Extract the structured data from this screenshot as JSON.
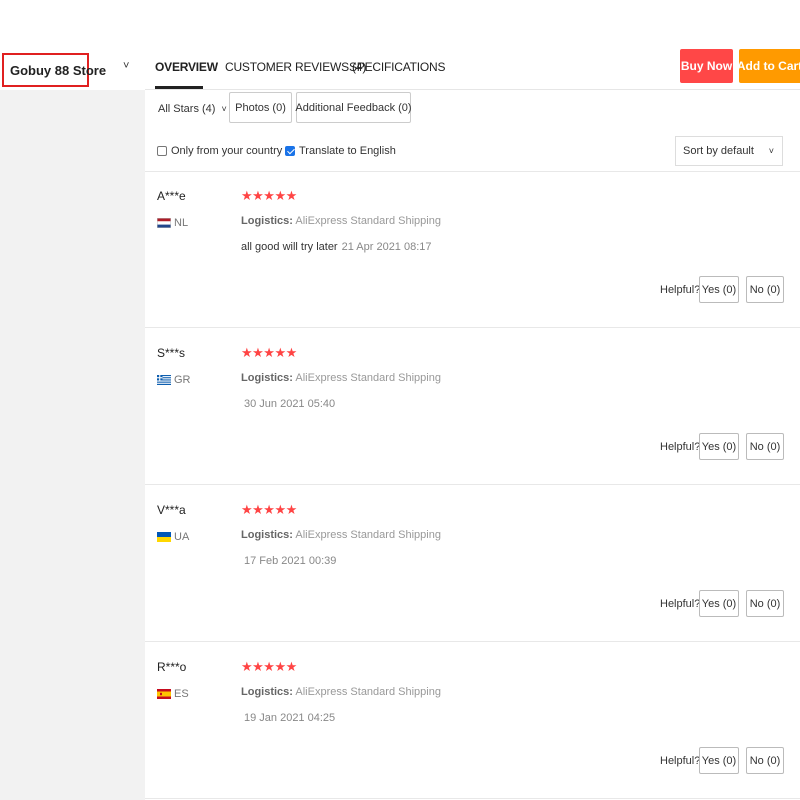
{
  "store": {
    "name": "Gobuy 88 Store"
  },
  "nav": {
    "tabs": [
      {
        "label": "OVERVIEW"
      },
      {
        "label": "CUSTOMER REVIEWS (4)"
      },
      {
        "label": "SPECIFICATIONS"
      }
    ],
    "buy_now": "Buy Now",
    "add_to_cart": "Add to Cart"
  },
  "filters": {
    "stars": "All Stars (4)",
    "photos": "Photos (0)",
    "additional": "Additional Feedback (0)",
    "only_country": "Only from your country",
    "translate": "Translate to English",
    "translate_checked": true,
    "only_country_checked": false,
    "sort": "Sort by default"
  },
  "icons": {
    "star": "★",
    "chevron": "˅"
  },
  "colors": {
    "buy_now": "#ff4747",
    "add_to_cart": "#ff9a00",
    "stars": "#ff4747",
    "highlight_border": "#e02020"
  },
  "reviews": [
    {
      "reviewer": "A***e",
      "country": "NL",
      "stars": 5,
      "stars_text": "★★★★★",
      "logistics_label": "Logistics:",
      "logistics_value": "AliExpress Standard Shipping",
      "text": "all good will try later",
      "date": "21 Apr 2021 08:17",
      "helpful": "Helpful?",
      "yes": "Yes (0)",
      "no": "No (0)"
    },
    {
      "reviewer": "S***s",
      "country": "GR",
      "stars": 5,
      "stars_text": "★★★★★",
      "logistics_label": "Logistics:",
      "logistics_value": "AliExpress Standard Shipping",
      "text": "",
      "date": "30 Jun 2021 05:40",
      "helpful": "Helpful?",
      "yes": "Yes (0)",
      "no": "No (0)"
    },
    {
      "reviewer": "V***a",
      "country": "UA",
      "stars": 5,
      "stars_text": "★★★★★",
      "logistics_label": "Logistics:",
      "logistics_value": "AliExpress Standard Shipping",
      "text": "",
      "date": "17 Feb 2021 00:39",
      "helpful": "Helpful?",
      "yes": "Yes (0)",
      "no": "No (0)"
    },
    {
      "reviewer": "R***o",
      "country": "ES",
      "stars": 5,
      "stars_text": "★★★★★",
      "logistics_label": "Logistics:",
      "logistics_value": "AliExpress Standard Shipping",
      "text": "",
      "date": "19 Jan 2021 04:25",
      "helpful": "Helpful?",
      "yes": "Yes (0)",
      "no": "No (0)"
    }
  ]
}
